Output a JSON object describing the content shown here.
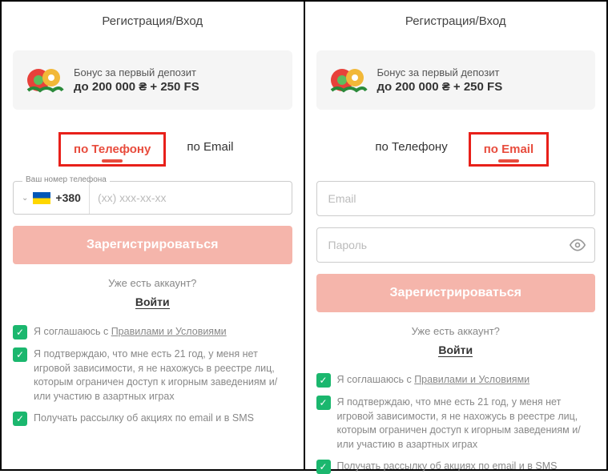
{
  "title": "Регистрация/Вход",
  "bonus": {
    "line1": "Бонус за первый депозит",
    "line2": "до 200 000 ₴ + 250 FS"
  },
  "tabs": {
    "phone": "по Телефону",
    "email": "по Email"
  },
  "phone": {
    "label": "Ваш номер телефона",
    "prefix": "+380",
    "placeholder": "(xx) xxx-xx-xx"
  },
  "email": {
    "email_placeholder": "Email",
    "password_placeholder": "Пароль"
  },
  "register_btn": "Зарегистрироваться",
  "already": "Уже есть аккаунт?",
  "login": "Войти",
  "checks": {
    "terms_prefix": "Я соглашаюсь с ",
    "terms_link": "Правилами и Условиями",
    "age": "Я подтверждаю, что мне есть 21 год, у меня нет игровой зависимости, я не нахожусь в реестре лиц, которым ограничен доступ к игорным заведениям и/или участию в азартных играх",
    "promo": "Получать рассылку об акциях по email и в SMS"
  }
}
